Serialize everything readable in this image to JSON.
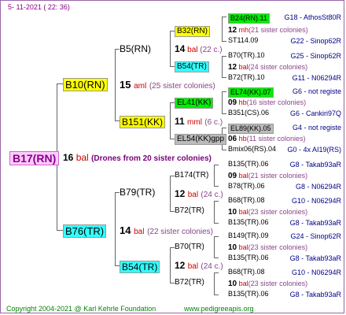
{
  "header": {
    "date": "5- 11-2021 ( 22: 36)"
  },
  "root": {
    "name": "B17(RN)",
    "number": "16",
    "mark": "bal",
    "remark": "(Drones from 20 sister colonies)"
  },
  "gen1": {
    "top": {
      "name": "B10(RN)",
      "number": "15",
      "mark": "aml",
      "remark": "(25 sister colonies)"
    },
    "bottom": {
      "name": "B76(TR)",
      "number": "14",
      "mark": "bal",
      "remark": "(22 sister colonies)"
    }
  },
  "gen2": [
    {
      "name": "B5(RN)"
    },
    {
      "name": "B151(KK)",
      "number": "11",
      "mark": "mml",
      "remark": "(6 c.)"
    },
    {
      "name": "B79(TR)",
      "number": "12",
      "mark": "bal",
      "remark": "(24 c.)"
    },
    {
      "name": "B54(TR)",
      "number": "12",
      "mark": "bal",
      "remark": "(24 c.)"
    }
  ],
  "gen3": [
    {
      "name": "B32(RN)",
      "number": "14",
      "mark": "bal",
      "remark": "(22 c.)"
    },
    {
      "name": "B54(TR)"
    },
    {
      "name": "EL41(KK)"
    },
    {
      "name": "EL54(KK)gpp"
    },
    {
      "name": "B174(TR)"
    },
    {
      "name": "B72(TR)"
    },
    {
      "name": "B70(TR)"
    },
    {
      "name": "B72(TR)"
    }
  ],
  "gen4": [
    {
      "name": "B24(RN).11",
      "code": "G18 - AthosSt80R"
    },
    {
      "number": "12",
      "mark": "mh",
      "remark": "(21 sister colonies)"
    },
    {
      "name": "ST114.09",
      "code": "G22 - Sinop62R"
    },
    {
      "name": "B70(TR).10",
      "code": "G25 - Sinop62R"
    },
    {
      "number": "12",
      "mark": "bal",
      "remark": "(24 sister colonies)"
    },
    {
      "name": "B72(TR).10",
      "code": "G11 - N06294R"
    },
    {
      "name": "EL74(KK).07",
      "code": "G6 - not registe"
    },
    {
      "number": "09",
      "mark": "hb",
      "remark": "(16 sister colonies)"
    },
    {
      "name": "B351(CS).06",
      "code": "G6 - Cankiri97Q"
    },
    {
      "name": "EL89(KK).05",
      "code": "G4 - not registe"
    },
    {
      "number": "06",
      "mark": "hb",
      "remark": "(11 sister colonies)"
    },
    {
      "name": "Bmix06(RS).04",
      "code": "G0 - 4x AI19(RS)"
    },
    {
      "name": "B135(TR).06",
      "code": "G8 - Takab93aR"
    },
    {
      "number": "09",
      "mark": "bal",
      "remark": "(21 sister colonies)"
    },
    {
      "name": "B78(TR).06",
      "code": "G8 - N06294R"
    },
    {
      "name": "B68(TR).08",
      "code": "G10 - N06294R"
    },
    {
      "number": "10",
      "mark": "bal",
      "remark": "(23 sister colonies)"
    },
    {
      "name": "B135(TR).06",
      "code": "G8 - Takab93aR"
    },
    {
      "name": "B149(TR).09",
      "code": "G24 - Sinop62R"
    },
    {
      "number": "10",
      "mark": "bal",
      "remark": "(23 sister colonies)"
    },
    {
      "name": "B135(TR).06",
      "code": "G8 - Takab93aR"
    },
    {
      "name": "B68(TR).08",
      "code": "G10 - N06294R"
    },
    {
      "number": "10",
      "mark": "bal",
      "remark": "(23 sister colonies)"
    },
    {
      "name": "B135(TR).06",
      "code": "G8 - Takab93aR"
    }
  ],
  "footer": {
    "copyright": "Copyright 2004-2021 @ Karl Kehrle Foundation",
    "url": "www.pedigreeapis.org"
  }
}
